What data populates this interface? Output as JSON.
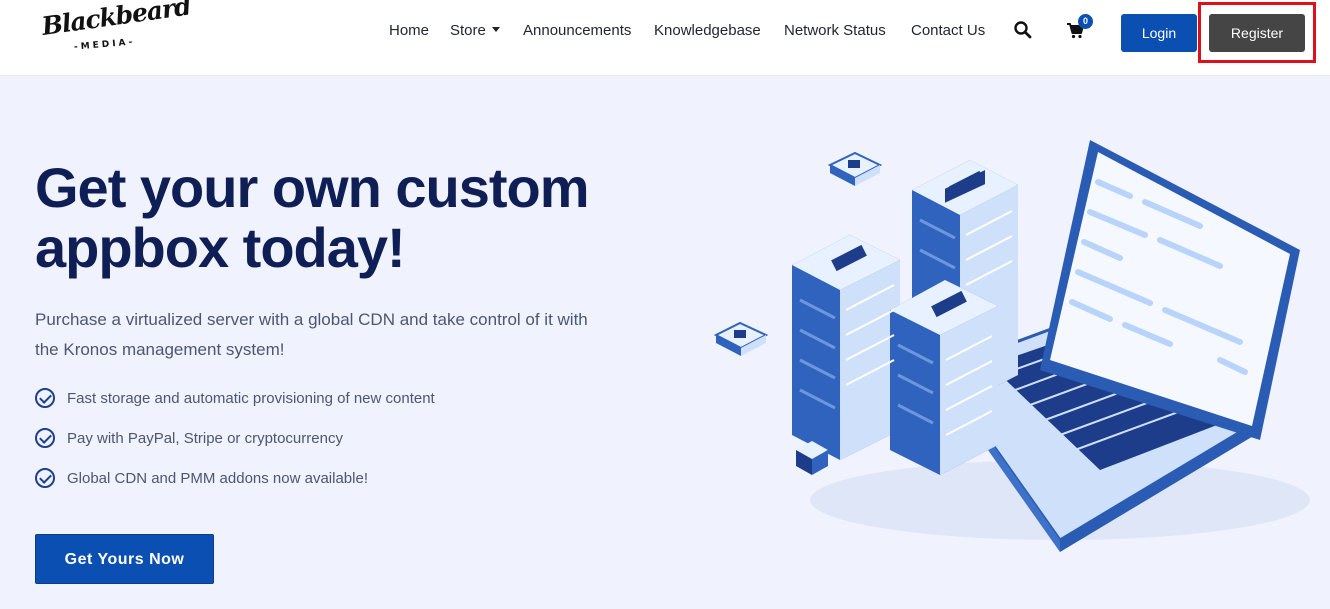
{
  "brand": {
    "script": "Blackbeard",
    "sub": "-MEDIA-"
  },
  "nav": {
    "items": [
      {
        "label": "Home"
      },
      {
        "label": "Store"
      },
      {
        "label": "Announcements"
      },
      {
        "label": "Knowledgebase"
      },
      {
        "label": "Network Status"
      },
      {
        "label": "Contact Us"
      }
    ],
    "cart_count": "0",
    "login_label": "Login",
    "register_label": "Register"
  },
  "hero": {
    "title_line1": "Get your own custom",
    "title_line2": "appbox today!",
    "description_line1": "Purchase a virtualized server with a global CDN and take control of it with",
    "description_line2": "the Kronos management system!",
    "features": [
      "Fast storage and automatic provisioning of new content",
      "Pay with PayPal, Stripe or cryptocurrency",
      "Global CDN and PMM addons now available!"
    ],
    "cta_label": "Get Yours Now"
  },
  "icons": [
    "search-icon",
    "cart-icon",
    "caret-down-icon",
    "check-circle-icon"
  ],
  "colors": {
    "accent": "#0c4fb3",
    "register": "#454545",
    "highlight": "#e0101a",
    "title": "#0f1e54",
    "background": "#f0f3fd"
  }
}
